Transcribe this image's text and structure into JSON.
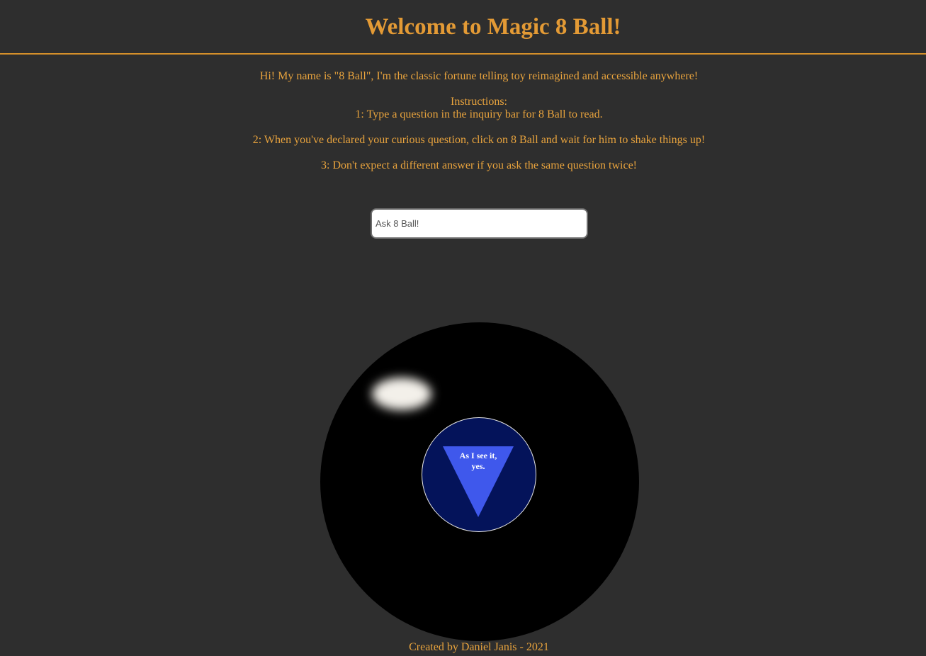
{
  "header": {
    "title": "Welcome to Magic 8 Ball!"
  },
  "intro": {
    "greeting": "Hi! My name is \"8 Ball\", I'm the classic fortune telling toy reimagined and accessible anywhere!",
    "instructions_heading": "Instructions:",
    "steps": [
      "1: Type a question in the inquiry bar for 8 Ball to read.",
      "2: When you've declared your curious question, click on 8 Ball and wait for him to shake things up!",
      "3: Don't expect a different answer if you ask the same question twice!"
    ]
  },
  "question_input": {
    "placeholder": "Ask 8 Ball!",
    "value": ""
  },
  "ball": {
    "answer": "As I see it, yes."
  },
  "footer": {
    "credit": "Created by Daniel Janis - 2021"
  },
  "colors": {
    "background": "#2e2e2e",
    "accent": "#e39a35",
    "ball": "#000000",
    "window": "#04135a",
    "triangle": "#3f58ec"
  }
}
